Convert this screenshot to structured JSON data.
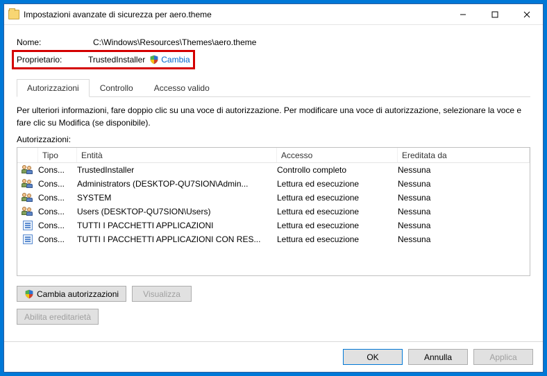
{
  "window": {
    "title": "Impostazioni avanzate di sicurezza per aero.theme"
  },
  "info": {
    "name_label": "Nome:",
    "name_value": "C:\\Windows\\Resources\\Themes\\aero.theme",
    "owner_label": "Proprietario:",
    "owner_value": "TrustedInstaller",
    "change_label": "Cambia"
  },
  "tabs": {
    "permissions": "Autorizzazioni",
    "auditing": "Controllo",
    "effective": "Accesso valido"
  },
  "body": {
    "hint": "Per ulteriori informazioni, fare doppio clic su una voce di autorizzazione. Per modificare una voce di autorizzazione, selezionare la voce e fare clic su Modifica (se disponibile).",
    "list_label": "Autorizzazioni:"
  },
  "columns": {
    "type": "Tipo",
    "entity": "Entità",
    "access": "Accesso",
    "inherited": "Ereditata da"
  },
  "rows": [
    {
      "icon": "group",
      "type": "Cons...",
      "entity": "TrustedInstaller",
      "access": "Controllo completo",
      "inherited": "Nessuna"
    },
    {
      "icon": "group",
      "type": "Cons...",
      "entity": "Administrators (DESKTOP-QU7SION\\Admin...",
      "access": "Lettura ed esecuzione",
      "inherited": "Nessuna"
    },
    {
      "icon": "group",
      "type": "Cons...",
      "entity": "SYSTEM",
      "access": "Lettura ed esecuzione",
      "inherited": "Nessuna"
    },
    {
      "icon": "group",
      "type": "Cons...",
      "entity": "Users (DESKTOP-QU7SION\\Users)",
      "access": "Lettura ed esecuzione",
      "inherited": "Nessuna"
    },
    {
      "icon": "app",
      "type": "Cons...",
      "entity": "TUTTI I PACCHETTI APPLICAZIONI",
      "access": "Lettura ed esecuzione",
      "inherited": "Nessuna"
    },
    {
      "icon": "app",
      "type": "Cons...",
      "entity": "TUTTI I PACCHETTI APPLICAZIONI CON RES...",
      "access": "Lettura ed esecuzione",
      "inherited": "Nessuna"
    }
  ],
  "buttons": {
    "change_perms": "Cambia autorizzazioni",
    "view": "Visualizza",
    "enable_inherit": "Abilita ereditarietà",
    "ok": "OK",
    "cancel": "Annulla",
    "apply": "Applica"
  }
}
